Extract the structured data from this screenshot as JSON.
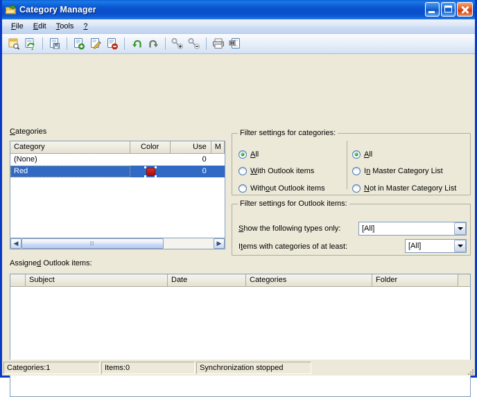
{
  "window": {
    "title": "Category Manager",
    "icon": "category-tag-icon",
    "min_label": "Minimize",
    "max_label": "Maximize",
    "close_label": "Close"
  },
  "menu": {
    "items": [
      {
        "label": "File",
        "accel": "F"
      },
      {
        "label": "Edit",
        "accel": "E"
      },
      {
        "label": "Tools",
        "accel": "T"
      },
      {
        "label": "?",
        "accel": ""
      }
    ]
  },
  "toolbar": {
    "buttons": [
      {
        "name": "find-categories-icon",
        "tooltip": "Find categories"
      },
      {
        "name": "synchronize-icon",
        "tooltip": "Synchronize"
      },
      {
        "name": "save-icon",
        "tooltip": "Save"
      },
      {
        "name": "new-category-icon",
        "tooltip": "New category"
      },
      {
        "name": "edit-category-icon",
        "tooltip": "Edit category"
      },
      {
        "name": "delete-category-icon",
        "tooltip": "Delete category"
      },
      {
        "name": "undo-icon",
        "tooltip": "Undo"
      },
      {
        "name": "redo-icon",
        "tooltip": "Redo"
      },
      {
        "name": "add-key-icon",
        "tooltip": "Add to Master Category List"
      },
      {
        "name": "remove-key-icon",
        "tooltip": "Remove from Master Category List"
      },
      {
        "name": "print-icon",
        "tooltip": "Print"
      },
      {
        "name": "print-preview-icon",
        "tooltip": "Print preview"
      }
    ]
  },
  "categories": {
    "label": "Categories",
    "label_accel": "C",
    "columns": [
      {
        "key": "category",
        "title": "Category",
        "align": "left"
      },
      {
        "key": "color",
        "title": "Color",
        "align": "center"
      },
      {
        "key": "use",
        "title": "Use",
        "align": "right"
      },
      {
        "key": "master",
        "title": "M",
        "align": "left"
      }
    ],
    "rows": [
      {
        "category": "(None)",
        "color": "",
        "use": "0",
        "master": "",
        "selected": false
      },
      {
        "category": "Red",
        "color": "#c51b1b",
        "use": "0",
        "master": "",
        "selected": true
      }
    ],
    "scrollbar": {
      "left_arrow": "◀",
      "right_arrow": "▶"
    }
  },
  "filter_categories": {
    "title": "Filter settings for categories:",
    "left_group": [
      {
        "label": "All",
        "accel": "",
        "checked": true
      },
      {
        "label": "With Outlook items",
        "accel": "W",
        "checked": false
      },
      {
        "label": "Without Outlook items",
        "accel": "o",
        "checked": false
      }
    ],
    "right_group": [
      {
        "label": "All",
        "accel": "",
        "checked": true
      },
      {
        "label": "In Master Category List",
        "accel": "n",
        "checked": false
      },
      {
        "label": "Not in Master Category List",
        "accel": "N",
        "checked": false
      }
    ]
  },
  "filter_items": {
    "title": "Filter settings for Outlook items:",
    "type_filter": {
      "label": "Show the following types only:",
      "label_accel": "S",
      "value": "[All]"
    },
    "count_filter": {
      "label": "Items with categories of at least:",
      "label_accel": "t",
      "value": "[All]"
    }
  },
  "assigned_items": {
    "label": "Assigned Outlook items:",
    "label_accel": "d",
    "columns": [
      {
        "title": "Subject"
      },
      {
        "title": "Date"
      },
      {
        "title": "Categories"
      },
      {
        "title": "Folder"
      }
    ],
    "rows": []
  },
  "statusbar": {
    "panes": [
      "Categories:1",
      "Items:0",
      "Synchronization stopped"
    ]
  }
}
